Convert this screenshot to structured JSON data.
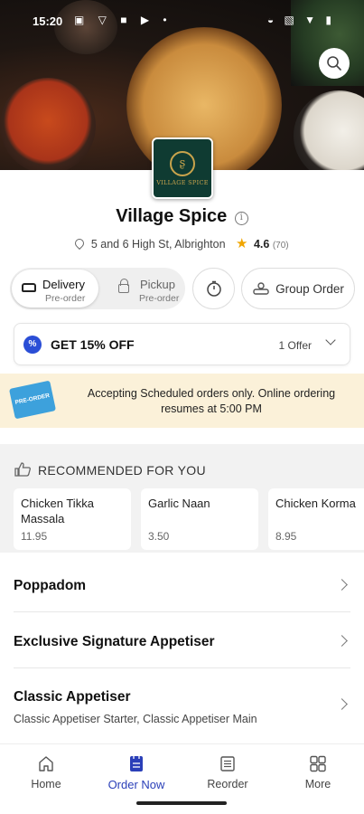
{
  "status_bar": {
    "time": "15:20"
  },
  "restaurant": {
    "name": "Village Spice",
    "logo_text": "VILLAGE SPICE",
    "address": "5 and 6 High St, Albrighton",
    "rating": "4.6",
    "rating_count": "(70)"
  },
  "order_mode": {
    "delivery_label": "Delivery",
    "delivery_sub": "Pre-order",
    "pickup_label": "Pickup",
    "pickup_sub": "Pre-order",
    "group_order_label": "Group Order"
  },
  "offer": {
    "badge": "%",
    "title": "GET 15% OFF",
    "count_label": "1 Offer"
  },
  "notice": {
    "tag": "PRE-ORDER",
    "text": "Accepting Scheduled orders only. Online ordering resumes at 5:00 PM"
  },
  "recommended": {
    "title": "RECOMMENDED FOR YOU",
    "items": [
      {
        "name": "Chicken Tikka Massala",
        "price": "11.95"
      },
      {
        "name": "Garlic Naan",
        "price": "3.50"
      },
      {
        "name": "Chicken Korma",
        "price": "8.95"
      }
    ]
  },
  "menu_categories": [
    {
      "title": "Poppadom",
      "subtitle": ""
    },
    {
      "title": "Exclusive Signature Appetiser",
      "subtitle": ""
    },
    {
      "title": "Classic Appetiser",
      "subtitle": "Classic Appetiser Starter, Classic Appetiser Main"
    }
  ],
  "bottom_nav": [
    {
      "label": "Home",
      "icon": "home-icon"
    },
    {
      "label": "Order Now",
      "icon": "order-icon"
    },
    {
      "label": "Reorder",
      "icon": "receipt-icon"
    },
    {
      "label": "More",
      "icon": "grid-icon"
    }
  ],
  "colors": {
    "accent": "#2a3fb8",
    "offer_badge": "#2a4ed6",
    "notice_bg": "#fbf1d9",
    "star": "#f0a500",
    "logo_bg": "#0f3b32",
    "logo_gold": "#c9a44c"
  }
}
